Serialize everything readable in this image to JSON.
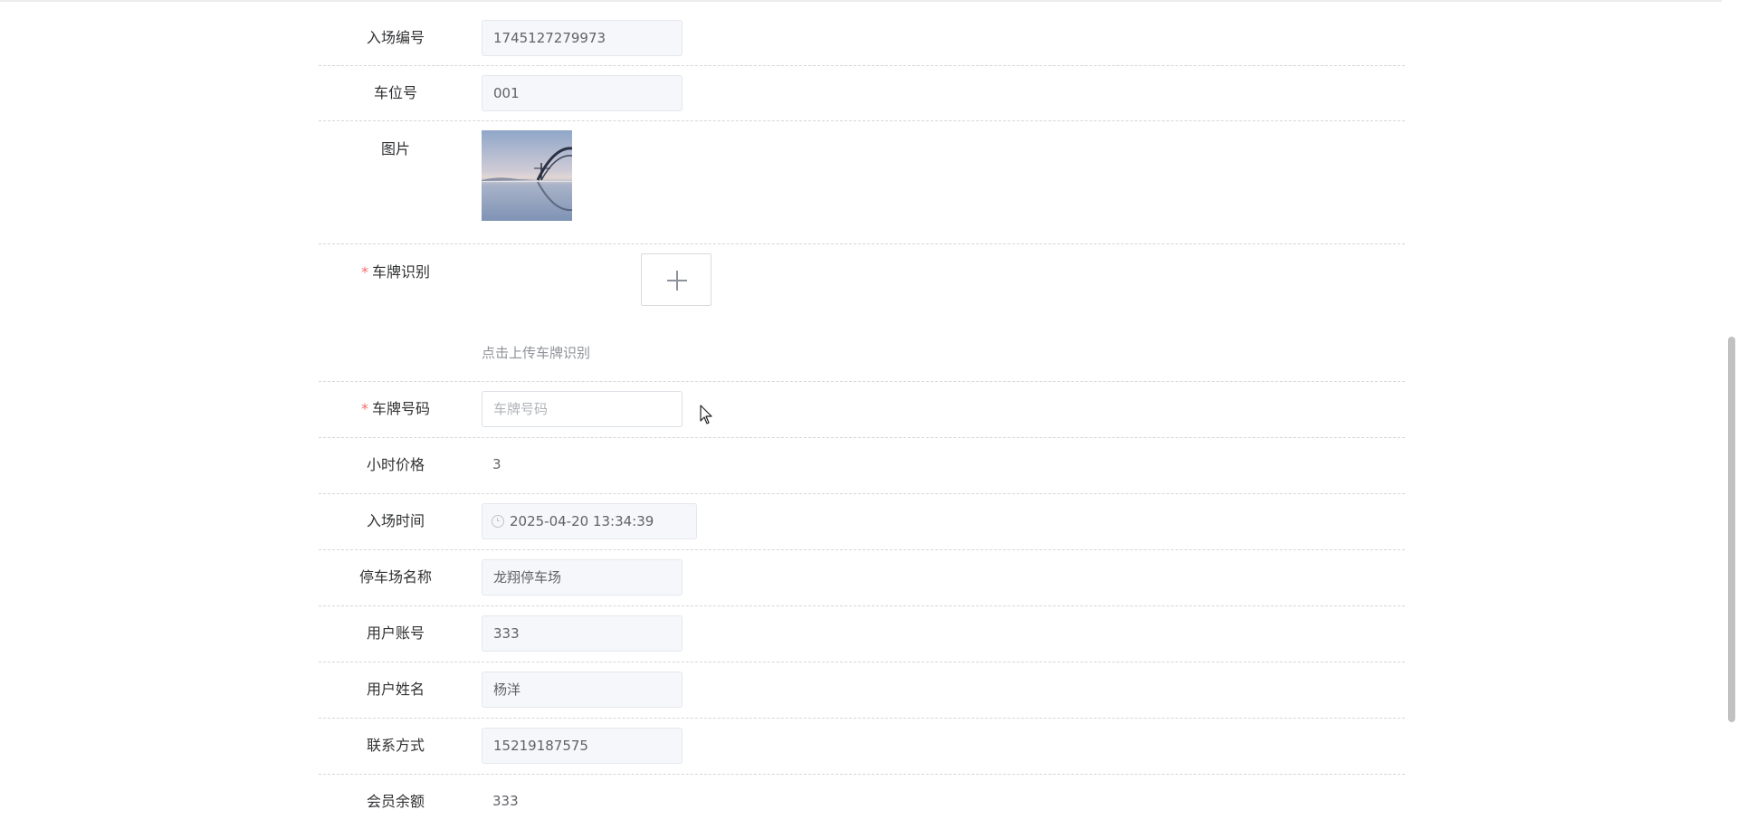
{
  "form": {
    "entry_no": {
      "label": "入场编号",
      "value": "1745127279973"
    },
    "space_no": {
      "label": "车位号",
      "value": "001"
    },
    "image": {
      "label": "图片"
    },
    "plate_recognition": {
      "required_mark": "*",
      "label": "车牌识别",
      "hint": "点击上传车牌识别"
    },
    "plate_number": {
      "required_mark": "*",
      "label": "车牌号码",
      "placeholder": "车牌号码",
      "value": ""
    },
    "hourly_price": {
      "label": "小时价格",
      "value": "3"
    },
    "entry_time": {
      "label": "入场时间",
      "value": "2025-04-20 13:34:39"
    },
    "lot_name": {
      "label": "停车场名称",
      "value": "龙翔停车场"
    },
    "user_account": {
      "label": "用户账号",
      "value": "333"
    },
    "user_name": {
      "label": "用户姓名",
      "value": "杨洋"
    },
    "contact": {
      "label": "联系方式",
      "value": "15219187575"
    },
    "member_balance": {
      "label": "会员余额",
      "value": "333"
    }
  },
  "icons": {
    "upload": "plus-icon",
    "time": "clock-icon",
    "pointer": "cursor-arrow-icon"
  },
  "colors": {
    "required": "#f56c6c",
    "disabled_bg": "#f5f7fa",
    "border": "#dcdfe6",
    "divider": "#d6d6d6"
  }
}
